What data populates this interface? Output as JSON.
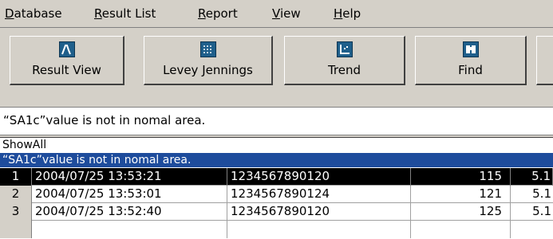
{
  "menu": [
    {
      "accel": "D",
      "rest": "atabase"
    },
    {
      "accel": "R",
      "rest": "esult List"
    },
    {
      "accel": "R",
      "rest": "eport"
    },
    {
      "accel": "V",
      "rest": "iew"
    },
    {
      "accel": "H",
      "rest": "elp"
    }
  ],
  "toolbar": {
    "result_view": {
      "label": "Result View",
      "icon": "result-view-icon"
    },
    "levey_jennings": {
      "label": "Levey Jennings",
      "icon": "levey-jennings-icon"
    },
    "trend": {
      "label": "Trend",
      "icon": "trend-icon"
    },
    "find": {
      "label": "Find",
      "icon": "find-icon"
    }
  },
  "message": "“SA1c”value is not in nomal area.",
  "filters": [
    {
      "label": "ShowAll"
    },
    {
      "label": "“SA1c”value is not in nomal area."
    }
  ],
  "rows": [
    {
      "num": "1",
      "datetime": "2004/07/25 13:53:21",
      "id": "1234567890120",
      "v1": "115",
      "v2": "5.1"
    },
    {
      "num": "2",
      "datetime": "2004/07/25 13:53:01",
      "id": "1234567890124",
      "v1": "121",
      "v2": "5.1"
    },
    {
      "num": "3",
      "datetime": "2004/07/25 13:52:40",
      "id": "1234567890120",
      "v1": "125",
      "v2": "5.1"
    }
  ],
  "colors": {
    "selection": "#1e4c9c",
    "face": "#d4d0c8",
    "icon": "#1f5f8b"
  }
}
